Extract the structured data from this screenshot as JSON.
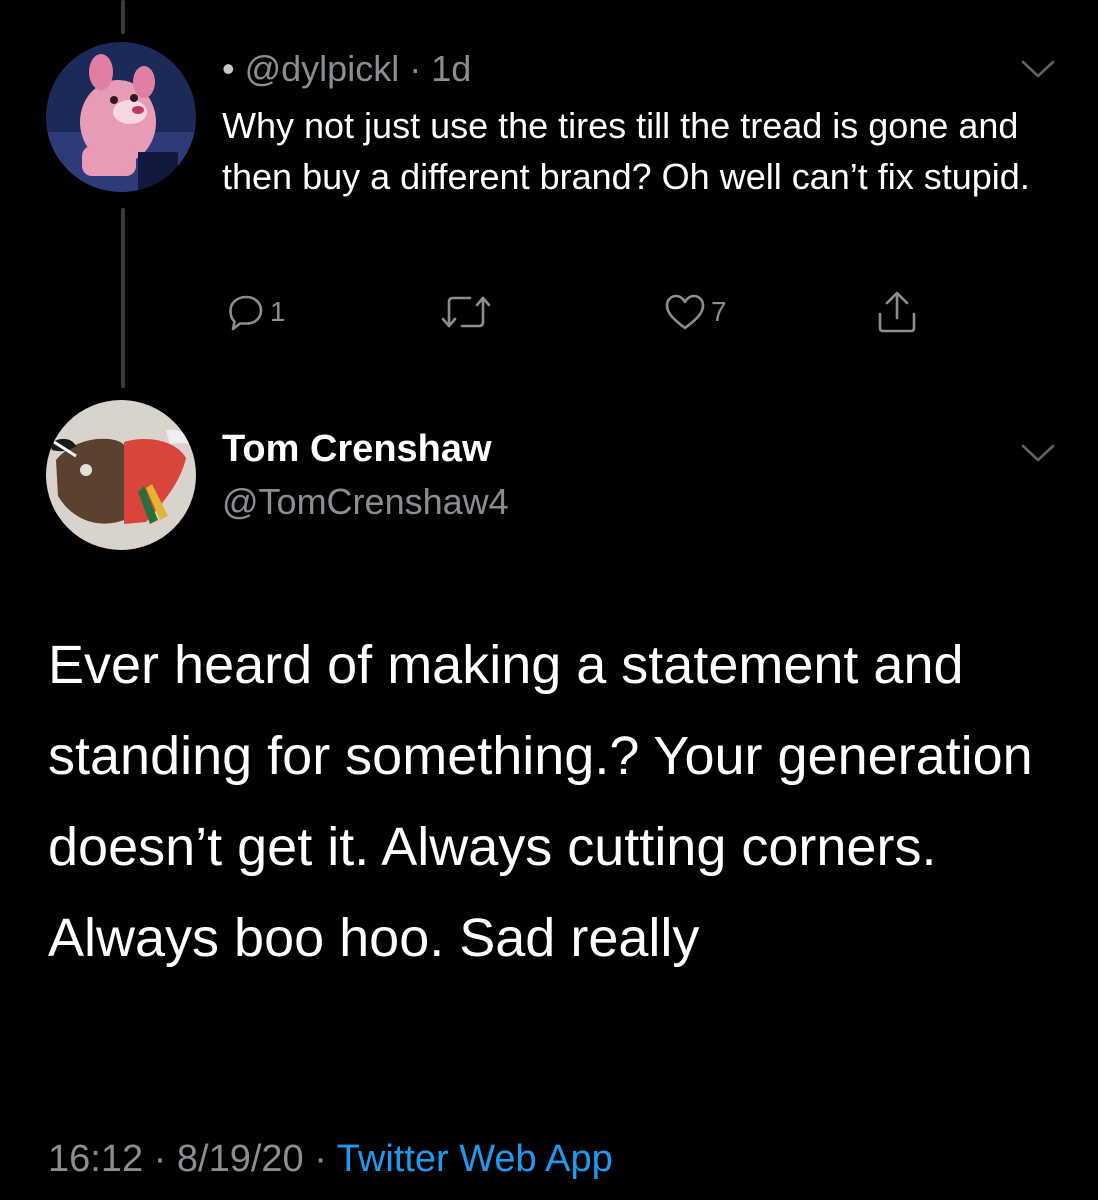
{
  "reply": {
    "handle": "@dylpickl",
    "separator": "·",
    "time": "1d",
    "text": "Why not just use the tires till the tread is gone and then buy a different brand? Oh well can’t fix stupid.",
    "reply_count": "1",
    "like_count": "7",
    "avatar_icon": "pink-panther-avatar"
  },
  "tweet": {
    "author_name": "Tom Crenshaw",
    "author_handle": "@TomCrenshaw4",
    "avatar_icon": "chicago-sports-logos-avatar",
    "text": "Ever heard of making a statement and standing for something.?  Your generation doesn’t get it.  Always cutting corners. Always boo hoo. Sad really",
    "time": "16:12",
    "date": "8/19/20",
    "source": "Twitter Web App",
    "separator": "·"
  },
  "icons": {
    "reply": "reply-icon",
    "retweet": "retweet-icon",
    "like": "heart-icon",
    "share": "share-icon",
    "more": "chevron-down-icon"
  },
  "colors": {
    "background": "#000000",
    "text_primary": "#ffffff",
    "text_secondary": "#8a8d91",
    "link": "#1d9bf0",
    "thread_line": "#3a3a3c"
  }
}
